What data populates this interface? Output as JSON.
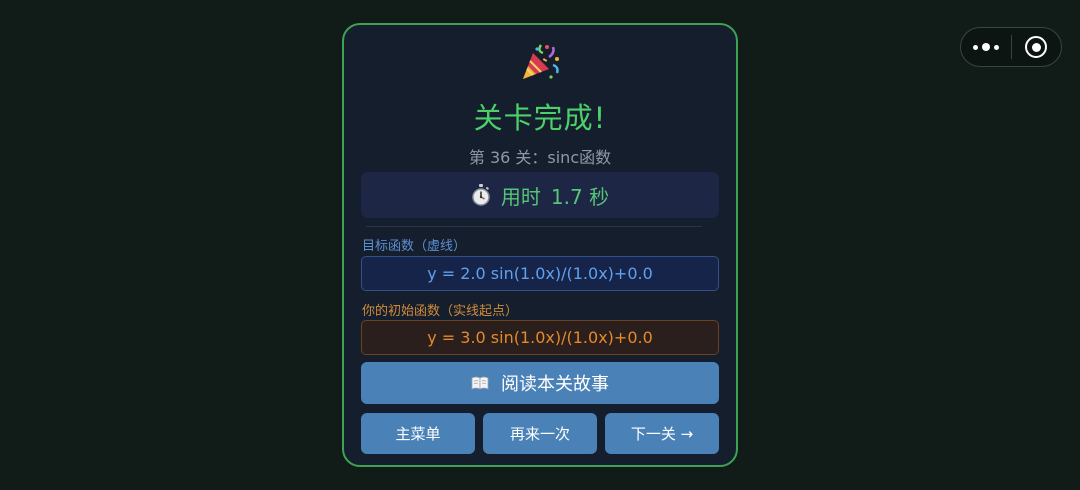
{
  "capsule": {
    "menu_icon": "more-dots-icon",
    "close_icon": "target-close-icon"
  },
  "card": {
    "title": "关卡完成!",
    "subtitle": "第 36 关：sinc函数",
    "time": {
      "label": "用时",
      "value": "1.7 秒",
      "icon": "stopwatch-icon"
    },
    "target_function": {
      "label": "目标函数（虚线）",
      "formula": "y = 2.0 sin(1.0x)/(1.0x)+0.0"
    },
    "initial_function": {
      "label": "你的初始函数（实线起点）",
      "formula": "y = 3.0 sin(1.0x)/(1.0x)+0.0"
    },
    "story_button": "阅读本关故事",
    "buttons": {
      "main_menu": "主菜单",
      "retry": "再来一次",
      "next": "下一关 →"
    }
  },
  "colors": {
    "background": "#111c18",
    "card_border": "#3fa250",
    "title": "#4cd06a",
    "button": "#4a82b8",
    "target_text": "#5ea1ef",
    "initial_text": "#e48a2a"
  }
}
